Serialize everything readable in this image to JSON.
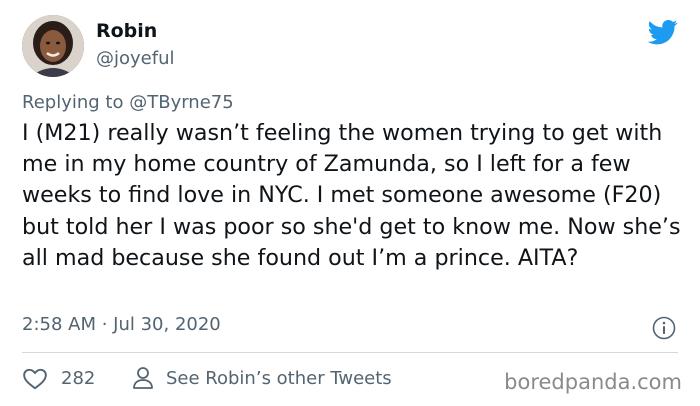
{
  "author": {
    "display_name": "Robin",
    "handle": "@joyeful",
    "avatar_icon": "user-avatar-photo"
  },
  "brand_icon": "twitter-bird-icon",
  "reply": {
    "prefix": "Replying to",
    "mention": "@TByrne75"
  },
  "tweet": {
    "text": "I (M21) really wasn’t feeling the women trying to get with me in my home country of Zamunda, so I left for a few weeks to find love in NYC. I met someone awesome (F20) but told her I was poor so she'd get to know me. Now she’s all mad because she found out I’m a prince. AITA?",
    "timestamp": "2:58 AM · Jul 30, 2020"
  },
  "actions": {
    "like_count": "282",
    "see_other_label": "See Robin’s other Tweets"
  },
  "watermark": "boredpanda.com",
  "colors": {
    "twitter_blue": "#1d9bf0",
    "secondary_text": "#536471",
    "divider": "#cfd9de"
  }
}
